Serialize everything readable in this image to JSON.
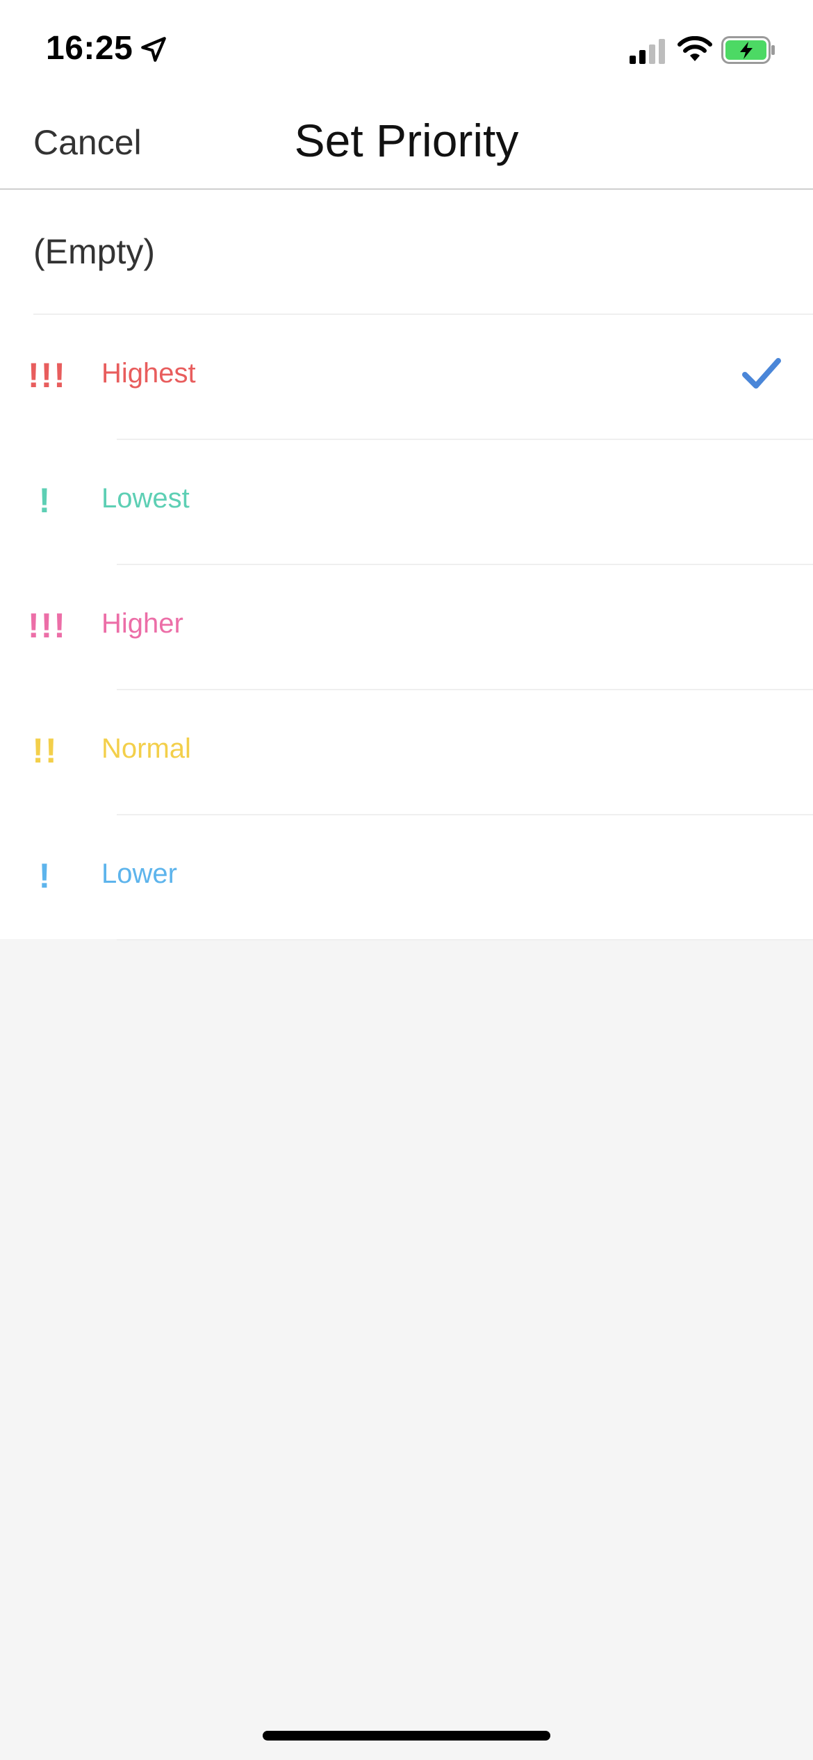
{
  "status_bar": {
    "time": "16:25",
    "icons": [
      "location-arrow-icon",
      "cellular-signal-icon",
      "wifi-icon",
      "battery-charging-icon"
    ],
    "battery_color": "#4cd964"
  },
  "nav": {
    "cancel_label": "Cancel",
    "title": "Set Priority"
  },
  "list": {
    "empty_label": "(Empty)",
    "selected_indicator": "checkmark-icon",
    "items": [
      {
        "marks": "!!!",
        "label": "Highest",
        "color": "#e85d5d",
        "selected": true
      },
      {
        "marks": "!",
        "label": "Lowest",
        "color": "#5dcfb4",
        "selected": false
      },
      {
        "marks": "!!!",
        "label": "Higher",
        "color": "#ec6ea7",
        "selected": false
      },
      {
        "marks": "!!",
        "label": "Normal",
        "color": "#f3cf4a",
        "selected": false
      },
      {
        "marks": "!",
        "label": "Lower",
        "color": "#5db4ec",
        "selected": false
      }
    ]
  },
  "accent_color": "#4a86d8"
}
